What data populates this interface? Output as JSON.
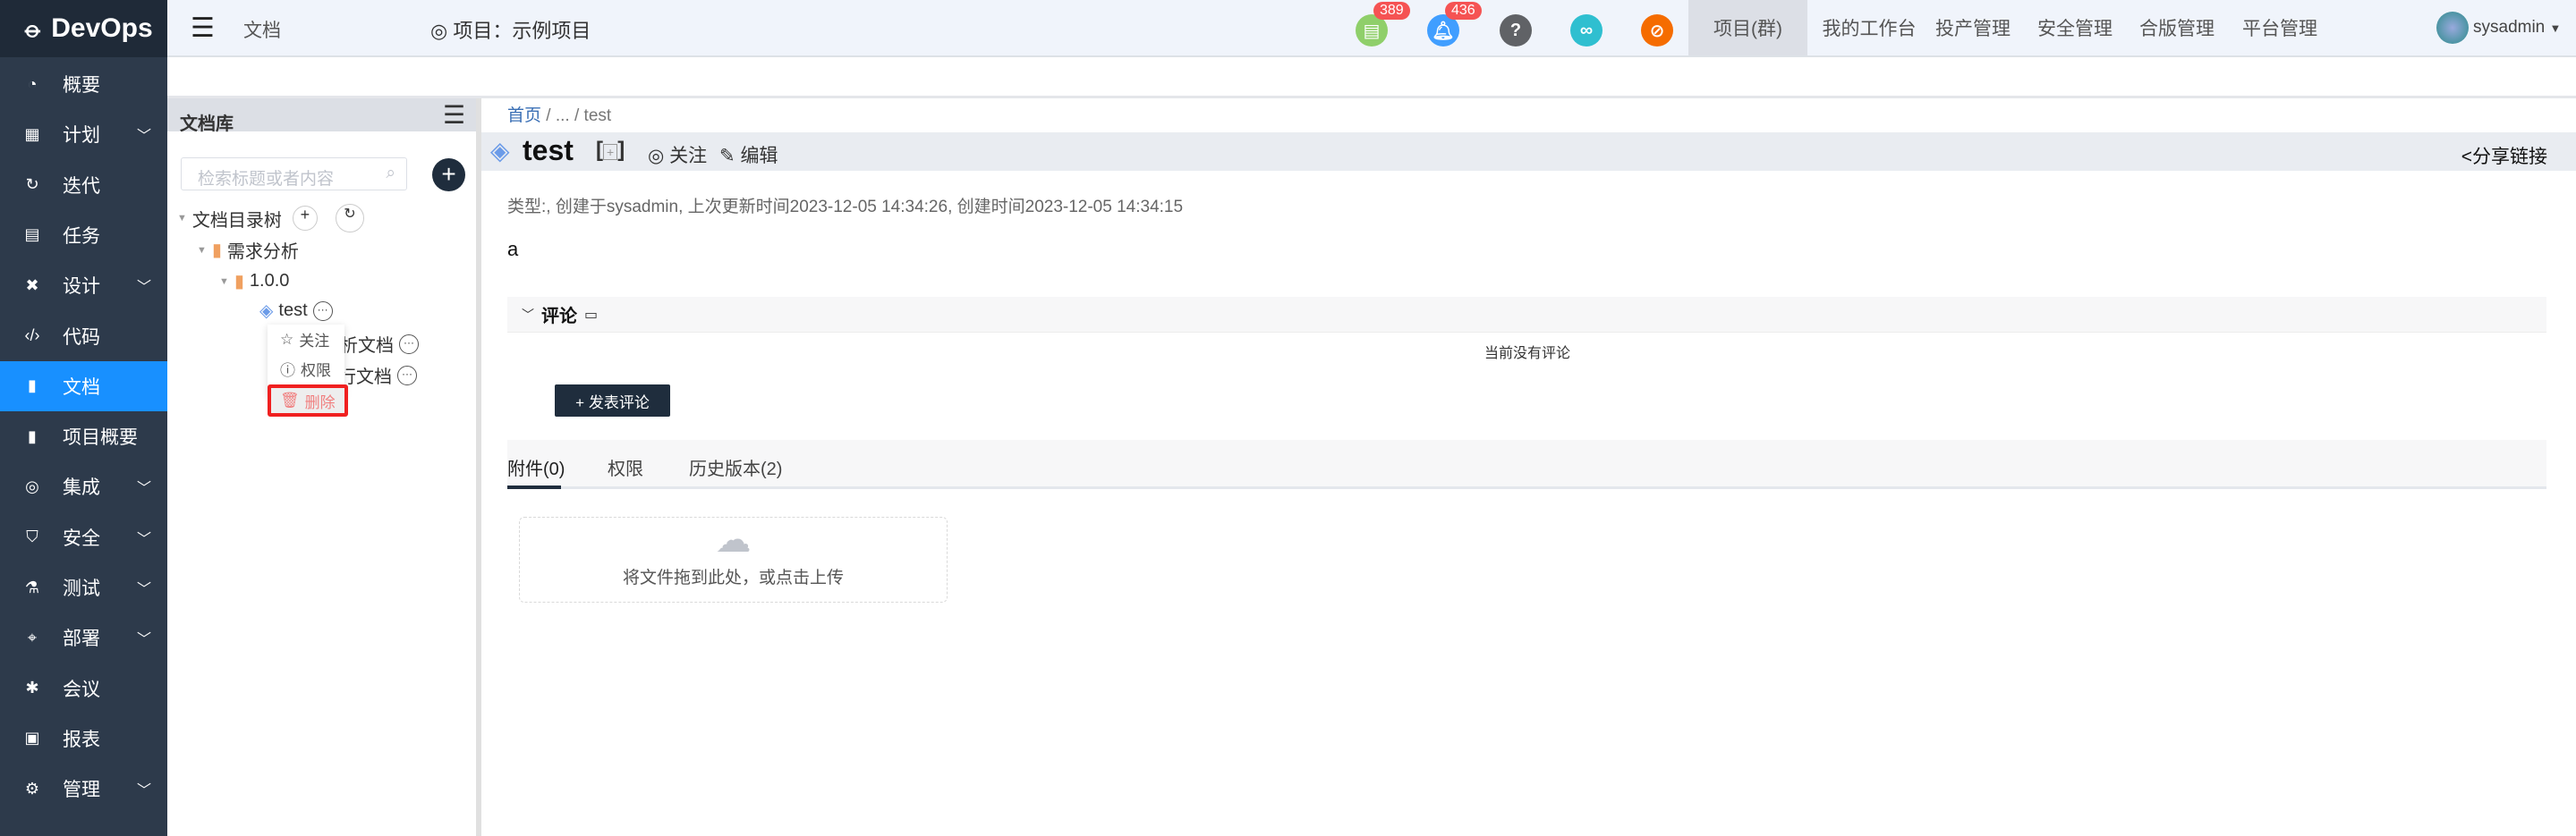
{
  "app": {
    "logo": "DevOps"
  },
  "sidebar": {
    "items": [
      {
        "label": "概要",
        "icon": "dashboard-icon"
      },
      {
        "label": "计划",
        "icon": "plan-icon",
        "chev": "﹀"
      },
      {
        "label": "迭代",
        "icon": "iteration-icon"
      },
      {
        "label": "任务",
        "icon": "task-icon"
      },
      {
        "label": "设计",
        "icon": "design-icon",
        "chev": "﹀"
      },
      {
        "label": "代码",
        "icon": "code-icon"
      },
      {
        "label": "文档",
        "icon": "document-icon",
        "active": true
      },
      {
        "label": "项目概要",
        "icon": "doc-icon"
      },
      {
        "label": "集成",
        "icon": "integration-icon",
        "chev": "﹀"
      },
      {
        "label": "安全",
        "icon": "shield-icon",
        "chev": "﹀"
      },
      {
        "label": "测试",
        "icon": "flask-icon",
        "chev": "﹀"
      },
      {
        "label": "部署",
        "icon": "deploy-icon",
        "chev": "﹀"
      },
      {
        "label": "会议",
        "icon": "meeting-icon"
      },
      {
        "label": "报表",
        "icon": "report-icon"
      },
      {
        "label": "管理",
        "icon": "gear-icon",
        "chev": "﹀"
      }
    ]
  },
  "header": {
    "page": "文档",
    "project": "项目：示例项目",
    "badges": {
      "docs": "389",
      "notify": "436"
    },
    "nav": [
      "项目(群)",
      "我的工作台",
      "投产管理",
      "安全管理",
      "合版管理",
      "平台管理"
    ],
    "user": "sysadmin"
  },
  "library": {
    "title": "文档库",
    "search_placeholder": "检索标题或者内容",
    "tree_root": "文档目录树",
    "folder": "需求分析",
    "version": "1.0.0",
    "doc": "test",
    "doc2": "分析文档",
    "doc3": "行文档",
    "menu": [
      "关注",
      "权限",
      "删除"
    ]
  },
  "doc": {
    "breadcrumb": [
      "首页",
      "...",
      "test"
    ],
    "title": "test",
    "follow": "关注",
    "edit": "编辑",
    "share": "分享链接",
    "meta": "类型:, 创建于sysadmin, 上次更新时间2023-12-05 14:34:26, 创建时间2023-12-05 14:34:15",
    "body": "a",
    "comments_title": "评论",
    "no_comments": "当前没有评论",
    "post_comment": "+ 发表评论",
    "tabs": [
      "附件(0)",
      "权限",
      "历史版本(2)"
    ],
    "upload": "将文件拖到此处，或点击上传"
  },
  "colors": {
    "sidebar": "#2d3a4b",
    "active": "#1890ff",
    "button": "#1f2d3d"
  }
}
